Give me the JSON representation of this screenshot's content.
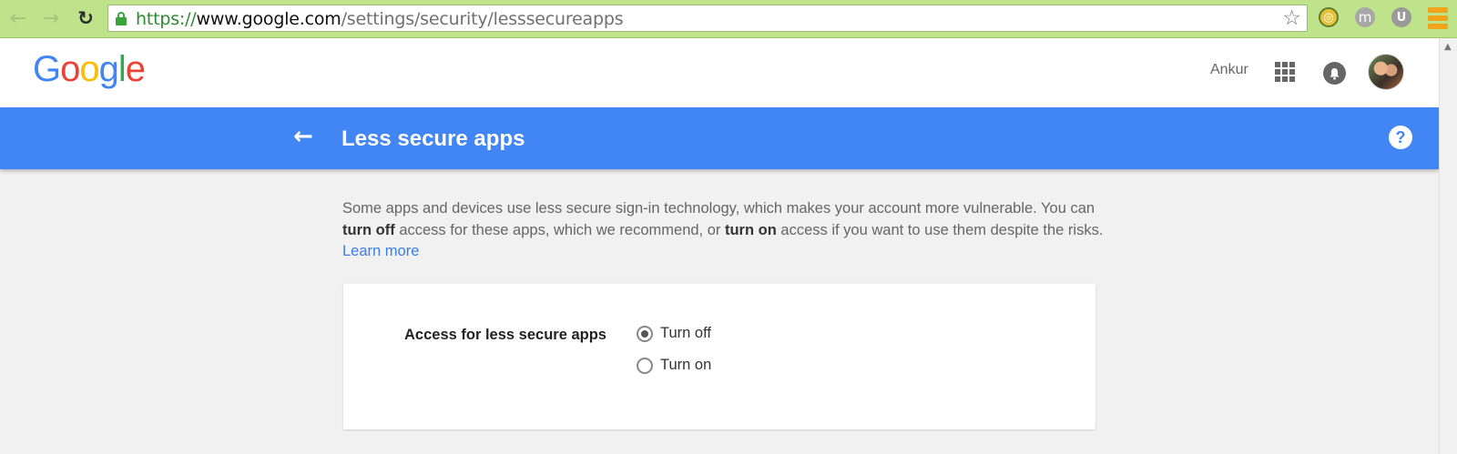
{
  "browser": {
    "url_scheme": "https://",
    "url_host": "www.google.com",
    "url_path": "/settings/security/lesssecureapps",
    "back_icon": "←",
    "forward_icon": "→",
    "reload_icon": "↻",
    "bookmark_icon": "☆",
    "extensions": [
      {
        "name": "extension-icon-1",
        "glyph": "◎"
      },
      {
        "name": "extension-icon-2",
        "glyph": "m"
      },
      {
        "name": "extension-icon-3",
        "glyph": "U"
      }
    ]
  },
  "header": {
    "logo": [
      "G",
      "o",
      "o",
      "g",
      "l",
      "e"
    ],
    "user_name": "Ankur",
    "bell_glyph": "🔔"
  },
  "titlebar": {
    "back_glyph": "←",
    "title": "Less secure apps",
    "help_glyph": "?"
  },
  "description": {
    "part1": "Some apps and devices use less secure sign-in technology, which makes your account more vulnerable. You can ",
    "bold1": "turn off",
    "part2": " access for these apps, which we recommend, or ",
    "bold2": "turn on",
    "part3": " access if you want to use them despite the risks. ",
    "link": "Learn more"
  },
  "access_card": {
    "label": "Access for less secure apps",
    "options": [
      {
        "label": "Turn off",
        "selected": true
      },
      {
        "label": "Turn on",
        "selected": false
      }
    ]
  },
  "colors": {
    "chrome_bar": "#bfe38a",
    "title_bar": "#4285f4",
    "link": "#3c7de6"
  }
}
